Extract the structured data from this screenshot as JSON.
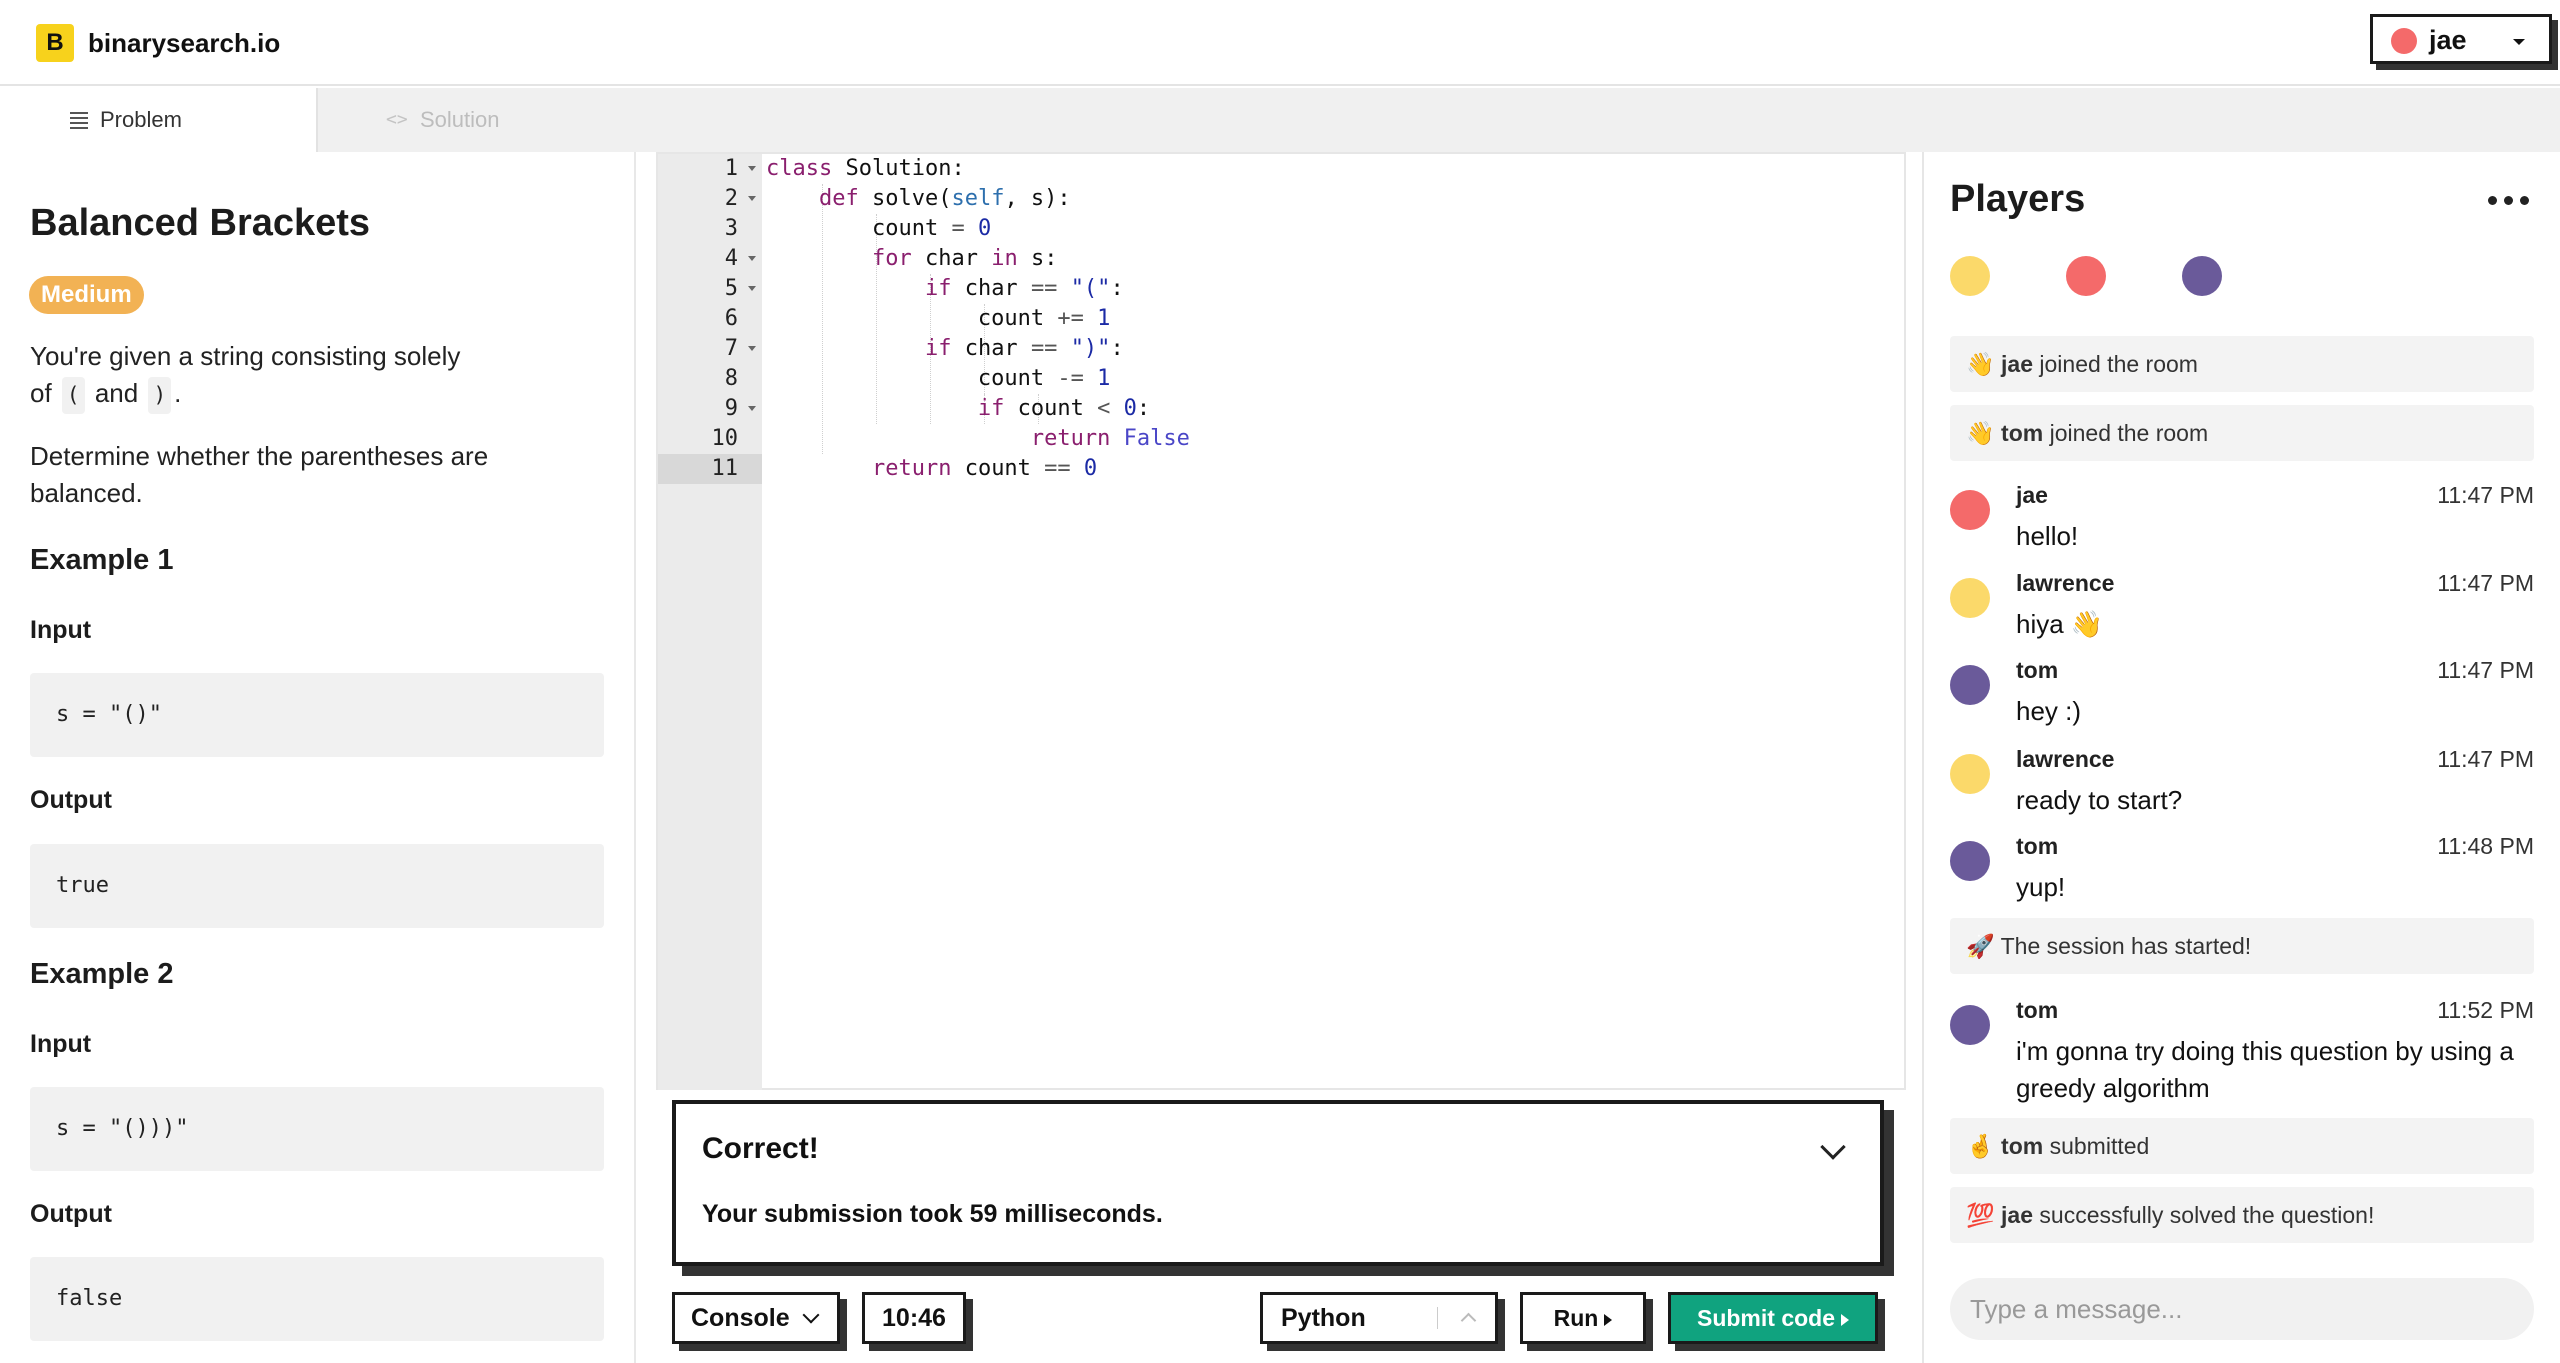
{
  "header": {
    "logo_letter": "B",
    "brand": "binarysearch.io",
    "user": {
      "name": "jae",
      "color": "#f46a6a"
    }
  },
  "tabs": [
    {
      "label": "Problem",
      "active": true,
      "icon": "list-icon"
    },
    {
      "label": "Solution",
      "active": false,
      "icon": "code-icon"
    }
  ],
  "problem": {
    "title": "Balanced Brackets",
    "difficulty": "Medium",
    "description_1a": "You're given a string consisting solely",
    "description_1b_prefix": "of",
    "description_1b_code1": "(",
    "description_1b_and": "and",
    "description_1b_code2": ")",
    "description_1b_suffix": ".",
    "description_2": "Determine whether the parentheses are balanced.",
    "examples": [
      {
        "heading": "Example 1",
        "input_label": "Input",
        "input": "s = \"()\"",
        "output_label": "Output",
        "output": "true"
      },
      {
        "heading": "Example 2",
        "input_label": "Input",
        "input": "s = \"()))\"",
        "output_label": "Output",
        "output": "false"
      }
    ]
  },
  "editor": {
    "line_numbers": [
      "1",
      "2",
      "3",
      "4",
      "5",
      "6",
      "7",
      "8",
      "9",
      "10",
      "11"
    ],
    "active_line": 11,
    "folds": [
      1,
      2,
      4,
      5,
      7,
      9
    ]
  },
  "result": {
    "title": "Correct!",
    "message_prefix": "Your submission took ",
    "message_value": "59",
    "message_suffix": " milliseconds."
  },
  "toolbar": {
    "console_label": "Console",
    "timer": "10:46",
    "language": "Python",
    "run_label": "Run",
    "submit_label": "Submit code",
    "submit_color": "#10a37f"
  },
  "players": {
    "title": "Players",
    "colors": [
      "#fbd96a",
      "#f46a6a",
      "#6a5a9a"
    ]
  },
  "chat": {
    "system": [
      {
        "emoji": "👋",
        "user": "jae",
        "text": " joined the room"
      },
      {
        "emoji": "👋",
        "user": "tom",
        "text": " joined the room"
      },
      {
        "emoji": "🚀",
        "user": "",
        "text": "The session has started!"
      },
      {
        "emoji": "🤞",
        "user": "tom",
        "text": " submitted"
      },
      {
        "emoji": "💯",
        "user": "jae",
        "text": " successfully solved the question!"
      }
    ],
    "messages": [
      {
        "user": "jae",
        "color": "#f46a6a",
        "time": "11:47 PM",
        "text": "hello!"
      },
      {
        "user": "lawrence",
        "color": "#fbd96a",
        "time": "11:47 PM",
        "text": "hiya 👋"
      },
      {
        "user": "tom",
        "color": "#6a5a9a",
        "time": "11:47 PM",
        "text": "hey :)"
      },
      {
        "user": "lawrence",
        "color": "#fbd96a",
        "time": "11:47 PM",
        "text": "ready to start?"
      },
      {
        "user": "tom",
        "color": "#6a5a9a",
        "time": "11:48 PM",
        "text": "yup!"
      },
      {
        "user": "tom",
        "color": "#6a5a9a",
        "time": "11:52 PM",
        "text": "i'm gonna try doing this question by using a greedy algorithm"
      }
    ],
    "input_placeholder": "Type a message..."
  }
}
